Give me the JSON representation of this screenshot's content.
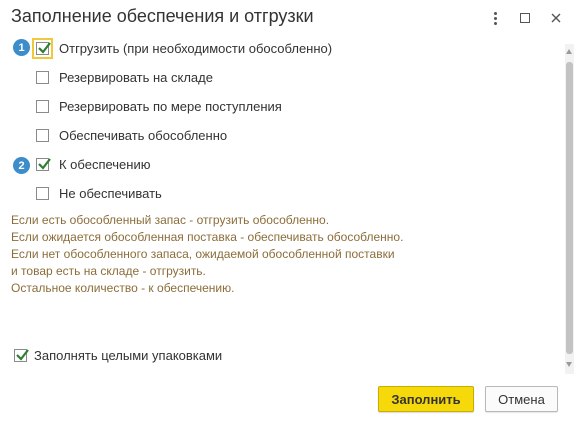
{
  "window": {
    "title": "Заполнение обеспечения и отгрузки"
  },
  "options": [
    {
      "badge": "1",
      "label": "Отгрузить (при необходимости обособленно)",
      "checked": true
    },
    {
      "badge": "",
      "label": "Резервировать на складе",
      "checked": false
    },
    {
      "badge": "",
      "label": "Резервировать по мере поступления",
      "checked": false
    },
    {
      "badge": "",
      "label": "Обеспечивать обособленно",
      "checked": false
    },
    {
      "badge": "2",
      "label": "К обеспечению",
      "checked": true
    },
    {
      "badge": "",
      "label": "Не обеспечивать",
      "checked": false
    }
  ],
  "hint_lines": [
    "Если есть обособленный запас - отгрузить обособленно.",
    "Если ожидается обособленная поставка - обеспечивать обособленно.",
    "Если нет обособленного запаса, ожидаемой обособленной поставки",
    "и товар есть на складе - отгрузить.",
    "Остальное количество - к обеспечению."
  ],
  "fill_by_packages": {
    "label": "Заполнять целыми упаковками",
    "checked": true
  },
  "buttons": {
    "fill": "Заполнить",
    "cancel": "Отмена"
  },
  "icons": {
    "more": "more-vertical-icon",
    "maximize": "maximize-icon",
    "close": "close-icon"
  },
  "colors": {
    "badge": "#3c8dc9",
    "primary_button": "#f5d90a",
    "hint_text": "#8b6d3a",
    "checkmark": "#2e7d32"
  }
}
